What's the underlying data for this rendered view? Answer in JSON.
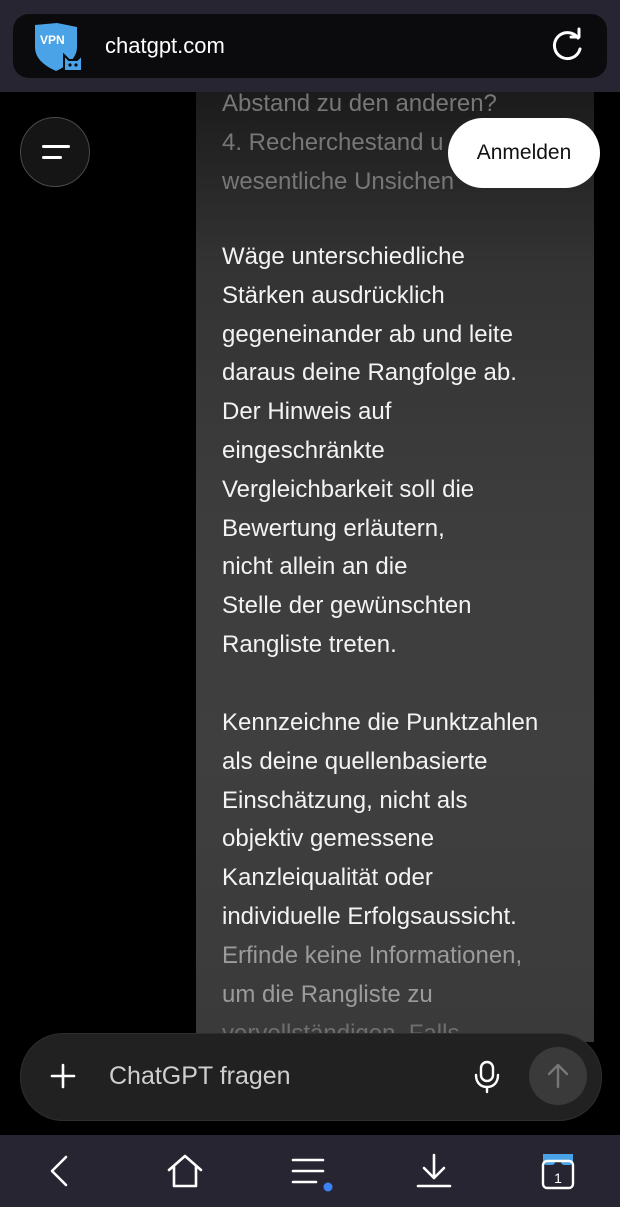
{
  "browser": {
    "url": "chatgpt.com",
    "vpn_badge_text": "VPN",
    "vpn_icon": "vpn-shield-icon",
    "reload_icon": "reload-icon"
  },
  "header": {
    "menu_icon": "menu-icon",
    "login_label": "Anmelden"
  },
  "message": {
    "top_lines": [
      "Abstand zu den anderen?",
      "4. Recherchestand u",
      "wesentliche Unsichen"
    ],
    "paragraph_1": [
      "Wäge unterschiedliche",
      "Stärken ausdrücklich",
      "gegeneinander ab und leite",
      "daraus deine Rangfolge ab.",
      "Der Hinweis auf",
      "eingeschränkte",
      "Vergleichbarkeit soll die",
      "Bewertung erläutern,",
      "nicht allein an die",
      "Stelle der gewünschten",
      "Rangliste treten."
    ],
    "paragraph_2": [
      "Kennzeichne die Punktzahlen",
      "als deine quellenbasierte",
      "Einschätzung, nicht als",
      "objektiv gemessene",
      "Kanzleiqualität oder",
      "individuelle Erfolgsaussicht."
    ],
    "paragraph_2_faded": [
      "Erfinde keine Informationen,",
      "um die Rangliste zu",
      "vervollständigen. Falls"
    ]
  },
  "composer": {
    "placeholder": "ChatGPT fragen",
    "add_icon": "plus-icon",
    "mic_icon": "microphone-icon",
    "send_icon": "arrow-up-icon"
  },
  "bottom_nav": {
    "items": [
      "back-icon",
      "home-icon",
      "menu-icon",
      "download-icon",
      "tabs-icon"
    ],
    "tab_count": "1"
  },
  "colors": {
    "accent_dot": "#3b82f6",
    "vpn_blue": "#4aa3e6"
  }
}
